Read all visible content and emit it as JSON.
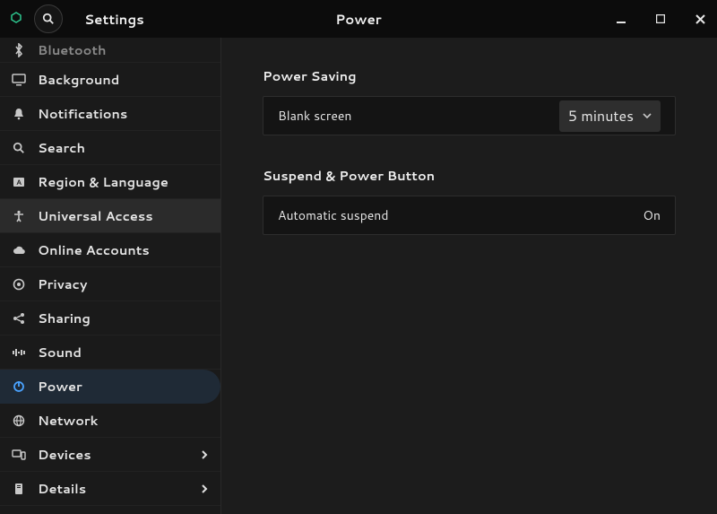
{
  "titlebar": {
    "app_title": "Settings",
    "panel_title": "Power"
  },
  "sidebar": {
    "items": [
      {
        "id": "bluetooth",
        "label": "Bluetooth",
        "icon": "bluetooth"
      },
      {
        "id": "background",
        "label": "Background",
        "icon": "monitor"
      },
      {
        "id": "notifications",
        "label": "Notifications",
        "icon": "bell"
      },
      {
        "id": "search",
        "label": "Search",
        "icon": "search"
      },
      {
        "id": "region",
        "label": "Region & Language",
        "icon": "lang"
      },
      {
        "id": "universal",
        "label": "Universal Access",
        "icon": "access",
        "highlight": true
      },
      {
        "id": "online",
        "label": "Online Accounts",
        "icon": "cloud"
      },
      {
        "id": "privacy",
        "label": "Privacy",
        "icon": "privacy"
      },
      {
        "id": "sharing",
        "label": "Sharing",
        "icon": "share"
      },
      {
        "id": "sound",
        "label": "Sound",
        "icon": "sound"
      },
      {
        "id": "power",
        "label": "Power",
        "icon": "power",
        "selected": true
      },
      {
        "id": "network",
        "label": "Network",
        "icon": "globe"
      },
      {
        "id": "devices",
        "label": "Devices",
        "icon": "devices",
        "chevron": true
      },
      {
        "id": "details",
        "label": "Details",
        "icon": "info",
        "chevron": true
      }
    ]
  },
  "sections": {
    "power_saving": {
      "title": "Power Saving",
      "blank_screen": {
        "label": "Blank screen",
        "value": "5 minutes"
      }
    },
    "suspend": {
      "title": "Suspend & Power Button",
      "auto_suspend": {
        "label": "Automatic suspend",
        "value": "On"
      }
    }
  }
}
